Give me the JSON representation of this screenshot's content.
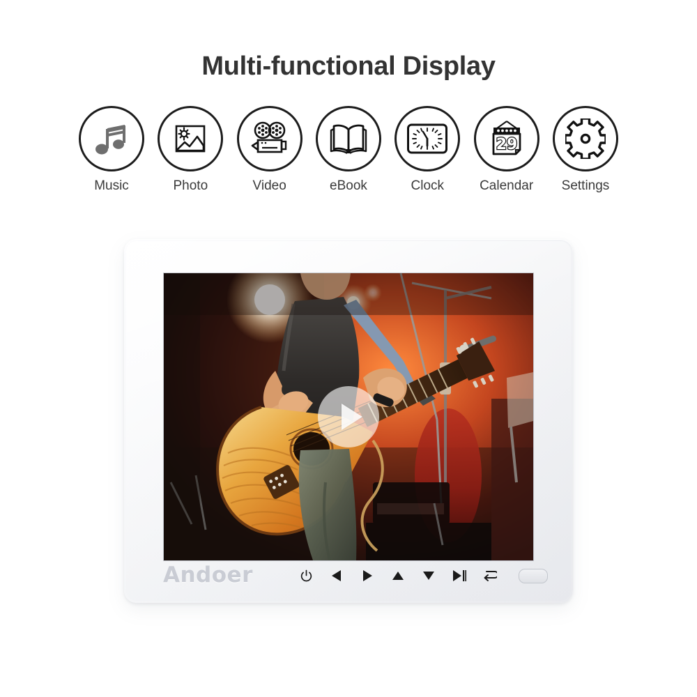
{
  "header": {
    "title": "Multi-functional Display"
  },
  "features": [
    {
      "label": "Music",
      "icon": "music-note-icon"
    },
    {
      "label": "Photo",
      "icon": "picture-icon"
    },
    {
      "label": "Video",
      "icon": "movie-camera-icon"
    },
    {
      "label": "eBook",
      "icon": "open-book-icon"
    },
    {
      "label": "Clock",
      "icon": "clock-icon"
    },
    {
      "label": "Calendar",
      "icon": "calendar-icon"
    },
    {
      "label": "Settings",
      "icon": "gear-icon"
    }
  ],
  "device": {
    "brand": "Andoer",
    "screen": {
      "content_description": "Guitarist performing on stage under warm red and orange concert lighting",
      "play_overlay": "play-button-overlay"
    },
    "controls": [
      {
        "name": "power-button",
        "glyph": "power"
      },
      {
        "name": "left-button",
        "glyph": "left"
      },
      {
        "name": "right-button",
        "glyph": "right"
      },
      {
        "name": "up-button",
        "glyph": "up"
      },
      {
        "name": "down-button",
        "glyph": "down"
      },
      {
        "name": "play-pause-button",
        "glyph": "play-pause"
      },
      {
        "name": "return-button",
        "glyph": "return"
      },
      {
        "name": "ir-sensor-window",
        "glyph": "ir"
      }
    ]
  },
  "colors": {
    "title_text": "#333333",
    "label_text": "#3a3a3a",
    "icon_stroke": "#1c1c1c",
    "music_icon_fill": "#6e6e6e",
    "brand_text": "#c9ccd4",
    "device_body": "#f4f5f7",
    "page_background": "#ffffff"
  },
  "calendar_icon_day": "29"
}
